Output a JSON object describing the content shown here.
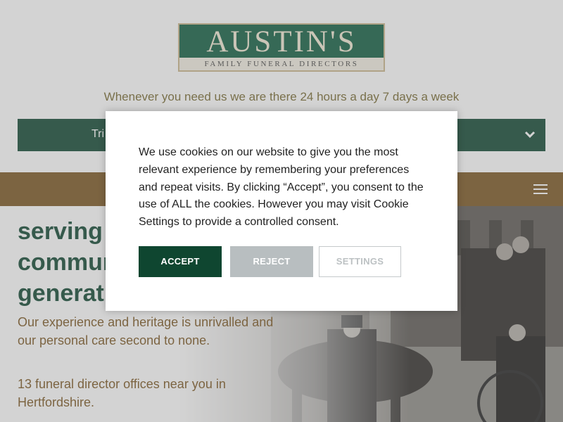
{
  "header": {
    "logo_main": "AUSTIN'S",
    "logo_sub": "FAMILY FUNERAL DIRECTORS",
    "tagline": "Whenever you need us we are there 24 hours a day 7 days a week",
    "branch_select_value": "Tri"
  },
  "hero": {
    "heading_line1": "serving t",
    "heading_line2": "commun",
    "heading_line3": "generati",
    "text1": "Our experience and heritage is unrivalled and our personal care second to none.",
    "text2": "13 funeral director offices near you in Hertfordshire."
  },
  "cookie_modal": {
    "message": "We use cookies on our website to give you the most relevant experience by remembering your preferences and repeat visits. By clicking “Accept”, you consent to the use of ALL the cookies. However you may visit Cookie Settings to provide a controlled consent.",
    "accept_label": "ACCEPT",
    "reject_label": "REJECT",
    "settings_label": "SETTINGS"
  },
  "colors": {
    "brand_green": "#0f4630",
    "brand_brown": "#7a5520",
    "tagline_gold": "#76682f",
    "reject_grey": "#b8bec0"
  },
  "icons": {
    "branch_dropdown": "chevron-down-icon",
    "nav_menu": "hamburger-menu-icon"
  }
}
